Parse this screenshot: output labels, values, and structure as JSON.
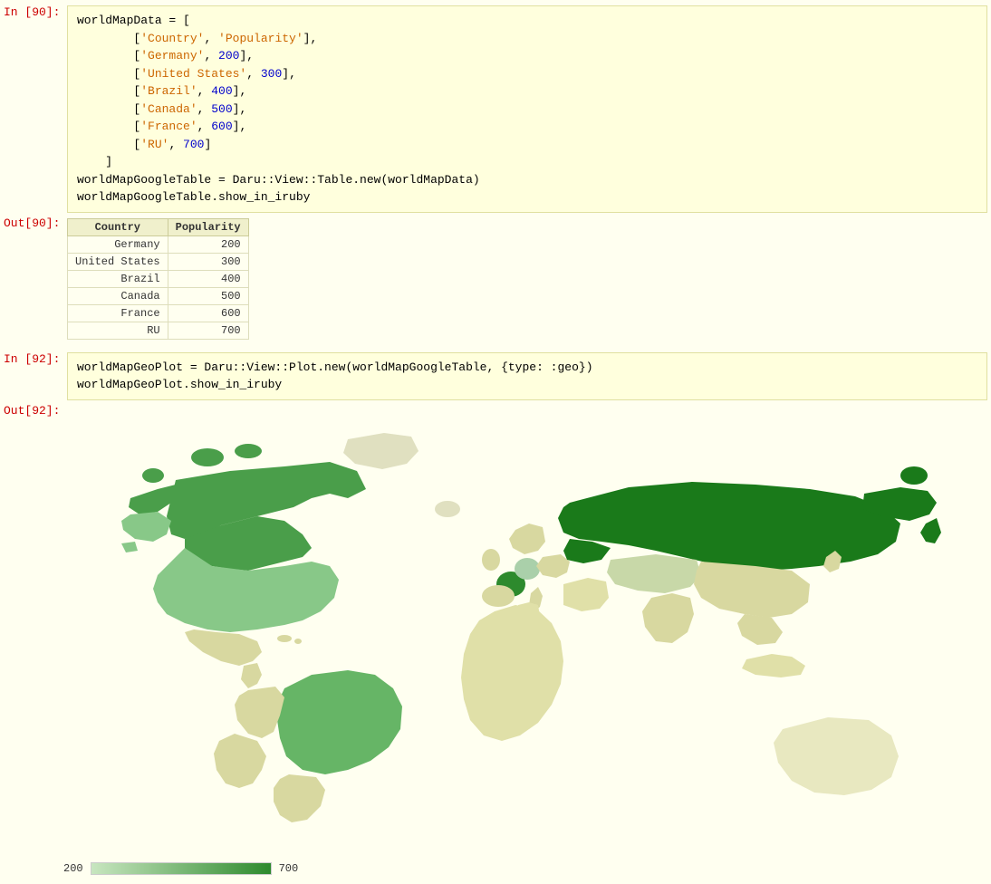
{
  "cells": {
    "in90": {
      "label": "In [90]:",
      "code_lines": [
        {
          "parts": [
            {
              "text": "worldMapData = [",
              "class": "code-plain"
            }
          ]
        },
        {
          "parts": [
            {
              "text": "        ['Country', 'Popularity'],",
              "class": "code-plain"
            },
            {
              "text": "",
              "class": ""
            },
            {
              "text": "",
              "class": ""
            }
          ]
        },
        {
          "parts": [
            {
              "text": "        ['Germany', 200],",
              "class": "code-plain"
            }
          ]
        },
        {
          "parts": [
            {
              "text": "        ['United States', 300],",
              "class": "code-plain"
            }
          ]
        },
        {
          "parts": [
            {
              "text": "        ['Brazil', 400],",
              "class": "code-plain"
            }
          ]
        },
        {
          "parts": [
            {
              "text": "        ['Canada', 500],",
              "class": "code-plain"
            }
          ]
        },
        {
          "parts": [
            {
              "text": "        ['France', 600],",
              "class": "code-plain"
            }
          ]
        },
        {
          "parts": [
            {
              "text": "        ['RU', 700]",
              "class": "code-plain"
            }
          ]
        },
        {
          "parts": [
            {
              "text": "    ]",
              "class": "code-plain"
            }
          ]
        },
        {
          "parts": [
            {
              "text": "worldMapGoogleTable = Daru::View::Table.new(worldMapData)",
              "class": "code-plain"
            }
          ]
        },
        {
          "parts": [
            {
              "text": "worldMapGoogleTable.show_in_iruby",
              "class": "code-plain"
            }
          ]
        }
      ]
    },
    "out90": {
      "label": "Out[90]:",
      "table": {
        "headers": [
          "Country",
          "Popularity"
        ],
        "rows": [
          [
            "Germany",
            "200"
          ],
          [
            "United States",
            "300"
          ],
          [
            "Brazil",
            "400"
          ],
          [
            "Canada",
            "500"
          ],
          [
            "France",
            "600"
          ],
          [
            "RU",
            "700"
          ]
        ]
      }
    },
    "in92": {
      "label": "In [92]:",
      "code_lines": [
        {
          "text": "worldMapGeoPlot = Daru::View::Plot.new(worldMapGoogleTable, {type: :geo})"
        },
        {
          "text": "worldMapGeoPlot.show_in_iruby"
        }
      ]
    },
    "out92": {
      "label": "Out[92]:"
    }
  },
  "legend": {
    "min_label": "200",
    "max_label": "700"
  },
  "colors": {
    "russia": "#1a7a1a",
    "canada": "#4ea04e",
    "brazil": "#5aaa5a",
    "usa": "#6ab86a",
    "france": "#3d8c3d",
    "germany": "#b8d9b8",
    "background": "#fffff0",
    "land_default": "#f0f0c8",
    "ocean": "#fffff0"
  }
}
